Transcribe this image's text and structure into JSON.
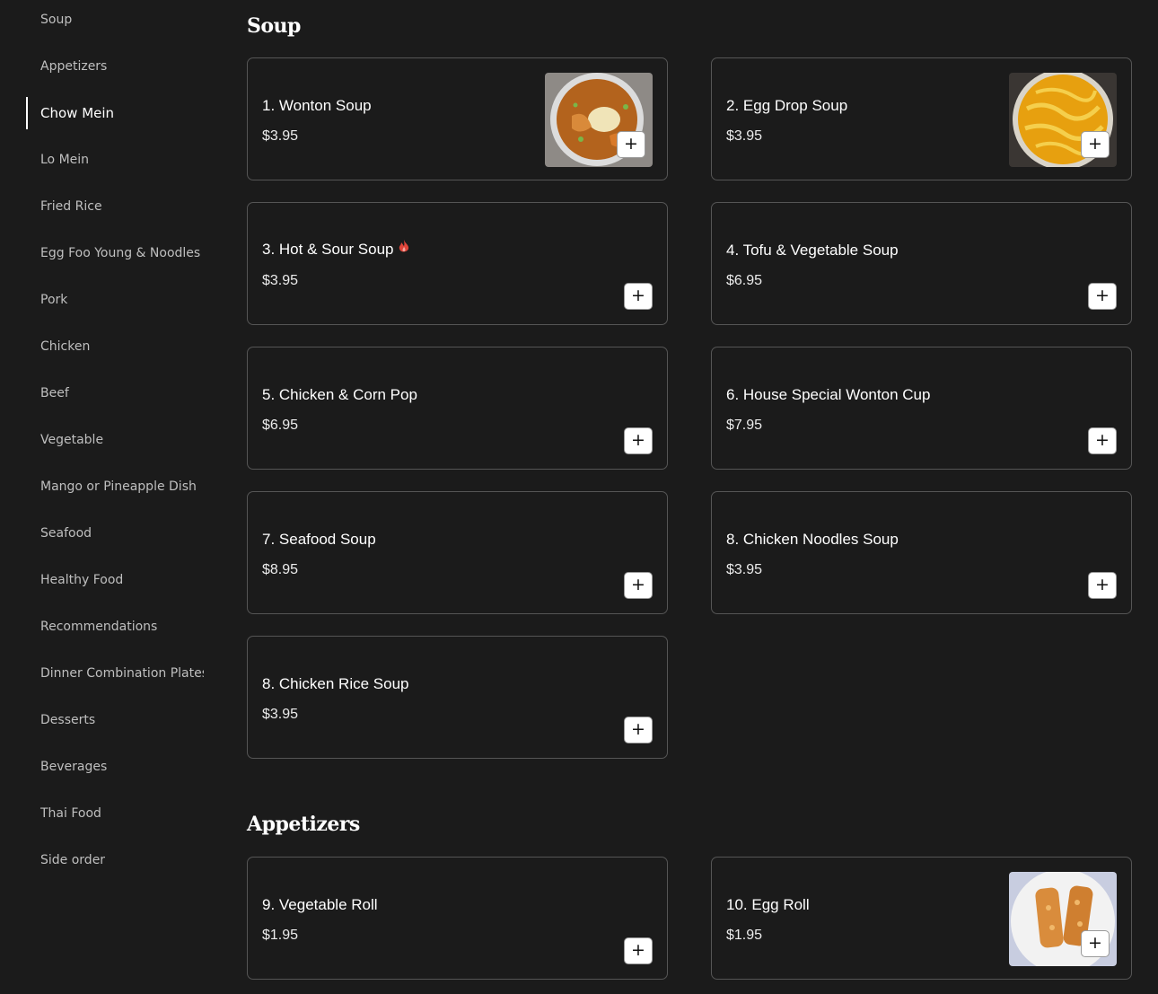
{
  "sidebar": {
    "items": [
      {
        "label": "Soup",
        "active": false
      },
      {
        "label": "Appetizers",
        "active": false
      },
      {
        "label": "Chow Mein",
        "active": true
      },
      {
        "label": "Lo Mein",
        "active": false
      },
      {
        "label": "Fried Rice",
        "active": false
      },
      {
        "label": "Egg Foo Young & Noodles",
        "active": false
      },
      {
        "label": "Pork",
        "active": false
      },
      {
        "label": "Chicken",
        "active": false
      },
      {
        "label": "Beef",
        "active": false
      },
      {
        "label": "Vegetable",
        "active": false
      },
      {
        "label": "Mango or Pineapple Dish",
        "active": false
      },
      {
        "label": "Seafood",
        "active": false
      },
      {
        "label": "Healthy Food",
        "active": false
      },
      {
        "label": "Recommendations",
        "active": false
      },
      {
        "label": "Dinner Combination Plates",
        "active": false
      },
      {
        "label": "Desserts",
        "active": false
      },
      {
        "label": "Beverages",
        "active": false
      },
      {
        "label": "Thai Food",
        "active": false
      },
      {
        "label": "Side order",
        "active": false
      }
    ]
  },
  "sections": {
    "soup": {
      "title": "Soup",
      "items": [
        {
          "name": "1. Wonton Soup",
          "price": "$3.95",
          "image": "wonton-soup-photo"
        },
        {
          "name": "2. Egg Drop Soup",
          "price": "$3.95",
          "image": "egg-drop-soup-photo"
        },
        {
          "name": "3. Hot & Sour Soup",
          "price": "$3.95",
          "spicy_icon": "flame-icon"
        },
        {
          "name": "4. Tofu & Vegetable Soup",
          "price": "$6.95"
        },
        {
          "name": "5. Chicken & Corn Pop",
          "price": "$6.95"
        },
        {
          "name": "6. House Special Wonton Cup",
          "price": "$7.95"
        },
        {
          "name": "7. Seafood Soup",
          "price": "$8.95"
        },
        {
          "name": "8. Chicken Noodles Soup",
          "price": "$3.95"
        },
        {
          "name": "8. Chicken Rice Soup",
          "price": "$3.95"
        }
      ]
    },
    "appetizers": {
      "title": "Appetizers",
      "items": [
        {
          "name": "9. Vegetable Roll",
          "price": "$1.95"
        },
        {
          "name": "10. Egg Roll",
          "price": "$1.95",
          "image": "egg-roll-photo"
        }
      ]
    }
  },
  "add_button_label": "+",
  "icons": {
    "add": "plus-icon",
    "spicy": "flame-icon"
  },
  "colors": {
    "background": "#1b1b1b",
    "card_border": "#555555",
    "spicy": "#e0453a",
    "text": "#ffffff",
    "muted_text": "#bfbfbf"
  }
}
